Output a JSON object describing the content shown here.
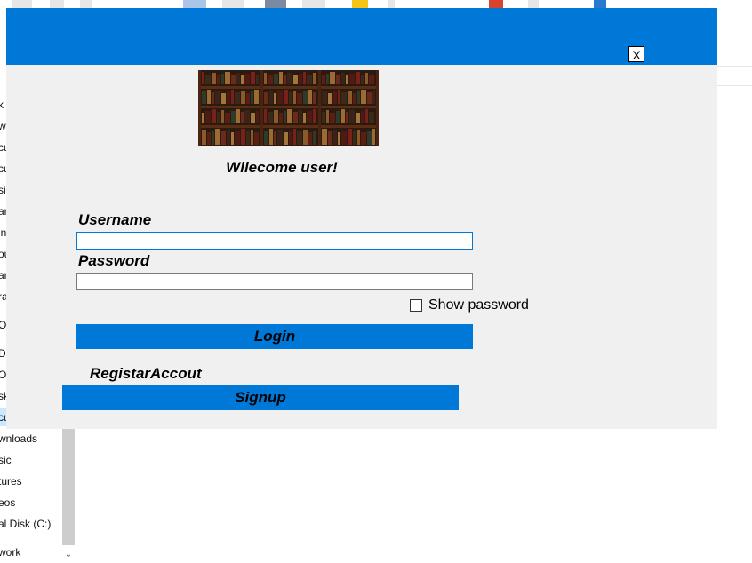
{
  "background_window": {
    "nav_items": [
      "k",
      "w",
      "cu",
      "cu",
      "si",
      "ar",
      "in",
      "ou",
      "an",
      "ra",
      "Or",
      "Dı",
      "O",
      "sk",
      "cu",
      "wnloads",
      "sic",
      "tures",
      "eos",
      "al Disk (C:)",
      "work"
    ],
    "scroll_down_glyph": "⌄"
  },
  "dialog": {
    "close_label": "X",
    "welcome_text": "Wllecome user!",
    "username_label": "Username",
    "username_value": "",
    "password_label": "Password",
    "password_value": "",
    "show_password_label": "Show password",
    "show_password_checked": false,
    "login_label": "Login",
    "register_label": "RegistarAccout",
    "signup_label": "Signup"
  },
  "colors": {
    "title_bar": "#0078d7",
    "button": "#0078d7",
    "dialog_bg": "#f0f0f0"
  }
}
